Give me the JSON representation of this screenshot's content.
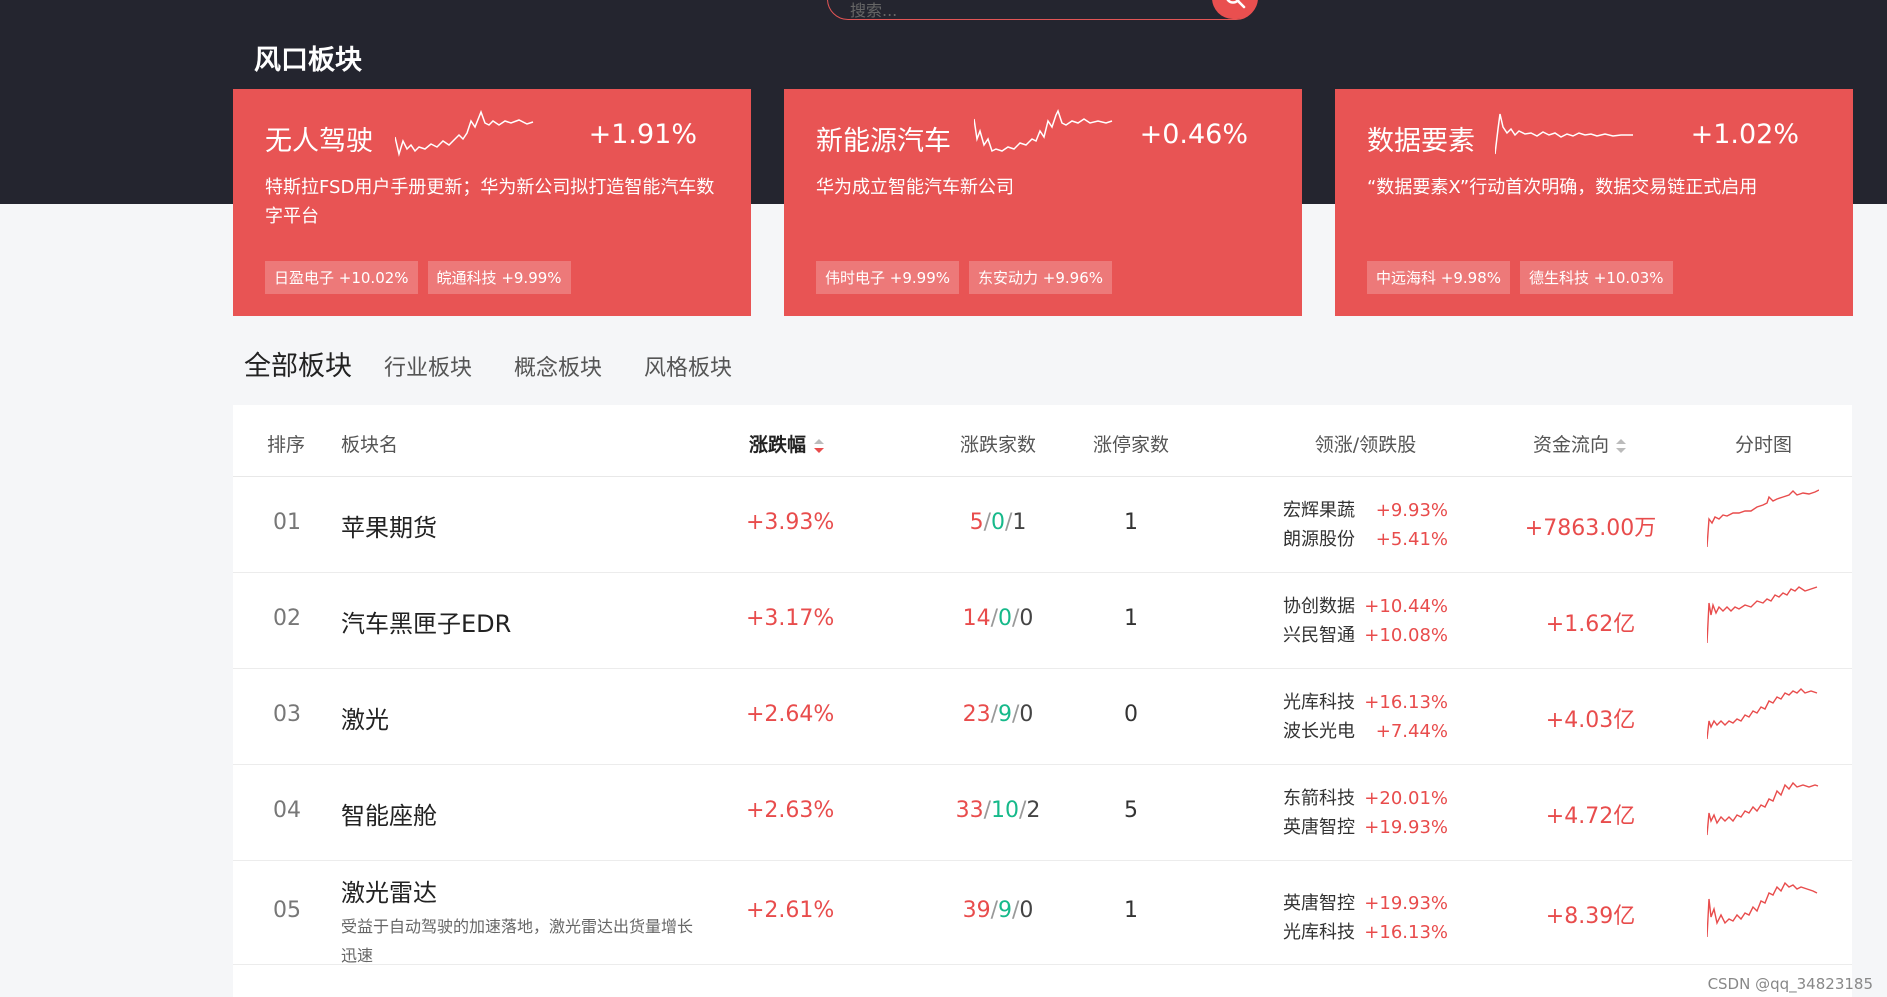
{
  "search": {
    "placeholder": "搜索..."
  },
  "hot": {
    "title": "风口板块",
    "cards": [
      {
        "name": "无人驾驶",
        "pct": "+1.91%",
        "desc": "特斯拉FSD用户手册更新；华为新公司拟打造智能汽车数字平台",
        "tags": [
          "日盈电子 +10.02%",
          "皖通科技 +9.99%"
        ]
      },
      {
        "name": "新能源汽车",
        "pct": "+0.46%",
        "desc": "华为成立智能汽车新公司",
        "tags": [
          "伟时电子 +9.99%",
          "东安动力 +9.96%"
        ]
      },
      {
        "name": "数据要素",
        "pct": "+1.02%",
        "desc": "“数据要素X”行动首次明确，数据交易链正式启用",
        "tags": [
          "中远海科 +9.98%",
          "德生科技 +10.03%"
        ]
      }
    ]
  },
  "tabs": [
    "全部板块",
    "行业板块",
    "概念板块",
    "风格板块"
  ],
  "table": {
    "headers": {
      "rank": "排序",
      "name": "板块名",
      "pct": "涨跌幅",
      "count": "涨跌家数",
      "limit": "涨停家数",
      "lead": "领涨/领跌股",
      "flow": "资金流向",
      "chart": "分时图"
    },
    "rows": [
      {
        "rank": "01",
        "name": "苹果期货",
        "desc": "",
        "pct": "+3.93%",
        "up": "5",
        "flat": "0",
        "down": "1",
        "limit": "1",
        "lead": [
          [
            "宏辉果蔬",
            "+9.93%"
          ],
          [
            "朗源股份",
            "+5.41%"
          ]
        ],
        "flow": "+7863.00万"
      },
      {
        "rank": "02",
        "name": "汽车黑匣子EDR",
        "desc": "",
        "pct": "+3.17%",
        "up": "14",
        "flat": "0",
        "down": "0",
        "limit": "1",
        "lead": [
          [
            "协创数据",
            "+10.44%"
          ],
          [
            "兴民智通",
            "+10.08%"
          ]
        ],
        "flow": "+1.62亿"
      },
      {
        "rank": "03",
        "name": "激光",
        "desc": "",
        "pct": "+2.64%",
        "up": "23",
        "flat": "9",
        "down": "0",
        "limit": "0",
        "lead": [
          [
            "光库科技",
            "+16.13%"
          ],
          [
            "波长光电",
            "+7.44%"
          ]
        ],
        "flow": "+4.03亿"
      },
      {
        "rank": "04",
        "name": "智能座舱",
        "desc": "",
        "pct": "+2.63%",
        "up": "33",
        "flat": "10",
        "down": "2",
        "limit": "5",
        "lead": [
          [
            "东箭科技",
            "+20.01%"
          ],
          [
            "英唐智控",
            "+19.93%"
          ]
        ],
        "flow": "+4.72亿"
      },
      {
        "rank": "05",
        "name": "激光雷达",
        "desc": "受益于自动驾驶的加速落地，激光雷达出货量增长迅速",
        "pct": "+2.61%",
        "up": "39",
        "flat": "9",
        "down": "0",
        "limit": "1",
        "lead": [
          [
            "英唐智控",
            "+19.93%"
          ],
          [
            "光库科技",
            "+16.13%"
          ]
        ],
        "flow": "+8.39亿"
      }
    ]
  },
  "colors": {
    "accent": "#e85454",
    "up": "#e84c4c",
    "flat": "#16b98a",
    "header_bg": "#24252f"
  },
  "icons": {
    "search": "search-icon",
    "sort": "sort-icon"
  },
  "watermark": "CSDN @qq_34823185"
}
